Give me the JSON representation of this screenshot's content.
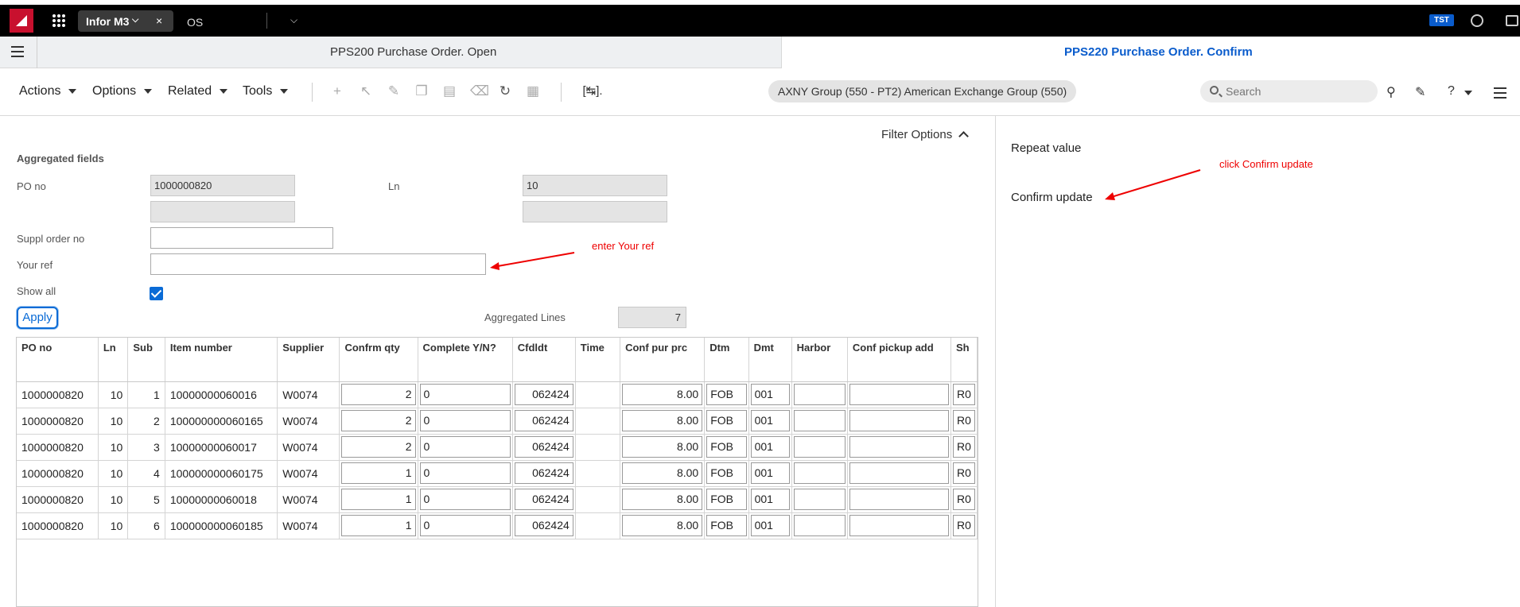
{
  "topbar": {
    "tab_active": "Infor M3",
    "tab_close": "×",
    "tab_second": "OS",
    "env_badge": "TST"
  },
  "subbar": {
    "left_panel_title": "PPS200 Purchase Order. Open",
    "right_panel_title": "PPS220 Purchase Order. Confirm"
  },
  "toolbar": {
    "menus": [
      "Actions",
      "Options",
      "Related",
      "Tools"
    ],
    "group_label": "AXNY Group (550 - PT2) American Exchange Group (550)",
    "search_placeholder": "Search",
    "help_icon": "?"
  },
  "form": {
    "filter_options": "Filter Options",
    "aggregated_title": "Aggregated fields",
    "po_no_label": "PO no",
    "po_no_value": "1000000820",
    "ln_label": "Ln",
    "ln_value": "10",
    "suppl_order_label": "Suppl order no",
    "suppl_order_value": "",
    "your_ref_label": "Your ref",
    "your_ref_value": "",
    "show_all_label": "Show all",
    "show_all_checked": true,
    "apply_label": "Apply",
    "agg_lines_label": "Aggregated Lines",
    "agg_lines_value": "7"
  },
  "annotations": {
    "your_ref": "enter Your ref",
    "confirm": "click Confirm update"
  },
  "table": {
    "headers": [
      "PO no",
      "Ln",
      "Sub",
      "Item number",
      "Supplier",
      "Confrm qty",
      "Complete Y/N?",
      "Cfdldt",
      "Time",
      "Conf pur prc",
      "Dtm",
      "Dmt",
      "Harbor",
      "Conf pickup add",
      "Sh"
    ],
    "rows": [
      {
        "po": "1000000820",
        "ln": "10",
        "sub": "1",
        "item": "10000000060016",
        "supplier": "W0074",
        "qty": "2",
        "complete": "0",
        "cfdldt": "062424",
        "time": "",
        "price": "8.00",
        "dtm": "FOB",
        "dmt": "001",
        "harbor": "",
        "pickup": "",
        "sh": "R0"
      },
      {
        "po": "1000000820",
        "ln": "10",
        "sub": "2",
        "item": "100000000060165",
        "supplier": "W0074",
        "qty": "2",
        "complete": "0",
        "cfdldt": "062424",
        "time": "",
        "price": "8.00",
        "dtm": "FOB",
        "dmt": "001",
        "harbor": "",
        "pickup": "",
        "sh": "R0"
      },
      {
        "po": "1000000820",
        "ln": "10",
        "sub": "3",
        "item": "10000000060017",
        "supplier": "W0074",
        "qty": "2",
        "complete": "0",
        "cfdldt": "062424",
        "time": "",
        "price": "8.00",
        "dtm": "FOB",
        "dmt": "001",
        "harbor": "",
        "pickup": "",
        "sh": "R0"
      },
      {
        "po": "1000000820",
        "ln": "10",
        "sub": "4",
        "item": "100000000060175",
        "supplier": "W0074",
        "qty": "1",
        "complete": "0",
        "cfdldt": "062424",
        "time": "",
        "price": "8.00",
        "dtm": "FOB",
        "dmt": "001",
        "harbor": "",
        "pickup": "",
        "sh": "R0"
      },
      {
        "po": "1000000820",
        "ln": "10",
        "sub": "5",
        "item": "10000000060018",
        "supplier": "W0074",
        "qty": "1",
        "complete": "0",
        "cfdldt": "062424",
        "time": "",
        "price": "8.00",
        "dtm": "FOB",
        "dmt": "001",
        "harbor": "",
        "pickup": "",
        "sh": "R0"
      },
      {
        "po": "1000000820",
        "ln": "10",
        "sub": "6",
        "item": "100000000060185",
        "supplier": "W0074",
        "qty": "1",
        "complete": "0",
        "cfdldt": "062424",
        "time": "",
        "price": "8.00",
        "dtm": "FOB",
        "dmt": "001",
        "harbor": "",
        "pickup": "",
        "sh": "R0"
      }
    ]
  },
  "right_panel": {
    "items": [
      "Repeat value",
      "Confirm update"
    ]
  },
  "colors": {
    "brand_red": "#c8102e",
    "accent_blue": "#0a5ccc",
    "annotation_red": "#e00000"
  }
}
